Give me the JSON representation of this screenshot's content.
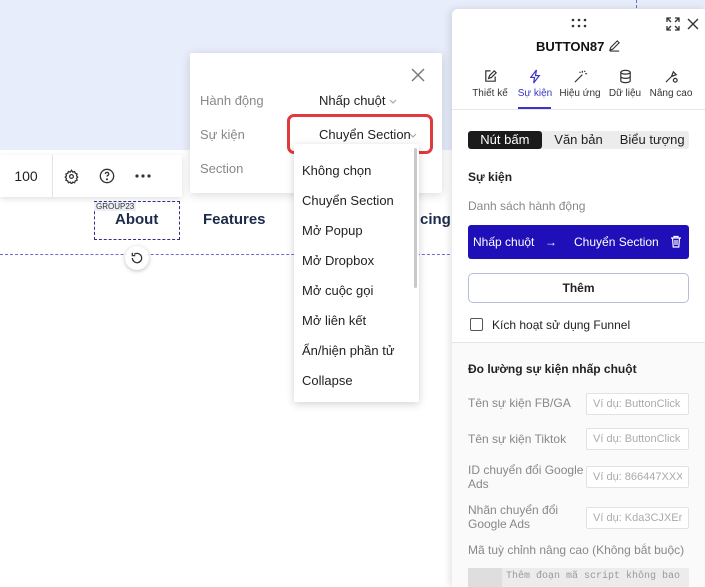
{
  "toolbar": {
    "value": "100",
    "icons": [
      "gear-icon",
      "help-icon",
      "more-icon"
    ]
  },
  "canvas": {
    "nav": [
      "About",
      "Features",
      "ricing"
    ],
    "group_tag": "GROUP23"
  },
  "popup": {
    "rows": [
      {
        "label": "Hành động",
        "value": "Nhấp chuột"
      },
      {
        "label": "Sự kiện",
        "value": "Chuyển Section"
      },
      {
        "label": "Section",
        "value": ""
      }
    ]
  },
  "dropdown": {
    "items": [
      "Không chọn",
      "Chuyển Section",
      "Mở Popup",
      "Mở Dropbox",
      "Mở cuộc gọi",
      "Mở liên kết",
      "Ẩn/hiện phần tử",
      "Collapse"
    ]
  },
  "panel": {
    "title": "BUTTON87",
    "tabs": [
      {
        "label": "Thiết kế",
        "icon": "edit-icon"
      },
      {
        "label": "Sự kiện",
        "icon": "lightning-icon",
        "active": true
      },
      {
        "label": "Hiệu ứng",
        "icon": "magic-wand-icon"
      },
      {
        "label": "Dữ liệu",
        "icon": "database-icon"
      },
      {
        "label": "Nâng cao",
        "icon": "settings-pen-icon"
      }
    ],
    "segments": [
      "Nút bấm",
      "Văn bản",
      "Biểu tượng"
    ],
    "events_heading": "Sự kiện",
    "actions_label": "Danh sách hành động",
    "action": {
      "trigger": "Nhấp chuột",
      "arrow": "→",
      "target": "Chuyển Section"
    },
    "add_label": "Thêm",
    "funnel_label": "Kích hoạt sử dụng Funnel",
    "tracking_heading": "Đo lường sự kiện nhấp chuột",
    "fields": [
      {
        "label": "Tên sự kiện FB/GA",
        "placeholder": "Ví dụ: ButtonClick"
      },
      {
        "label": "Tên sự kiện Tiktok",
        "placeholder": "Ví dụ: ButtonClick"
      },
      {
        "label": "ID chuyển đổi Google Ads",
        "placeholder": "Ví dụ: 866447XXX"
      },
      {
        "label": "Nhãn chuyển đổi Google Ads",
        "placeholder": "Ví dụ: Kda3CJXEr"
      }
    ],
    "custom_label": "Mã tuỳ chỉnh nâng cao (Không bắt buộc)",
    "code_placeholder": "Thêm đoạn mã script không bao"
  },
  "colors": {
    "accent": "#1e0fb8",
    "highlight": "#e0393e",
    "canvas": "#e8edfb"
  }
}
